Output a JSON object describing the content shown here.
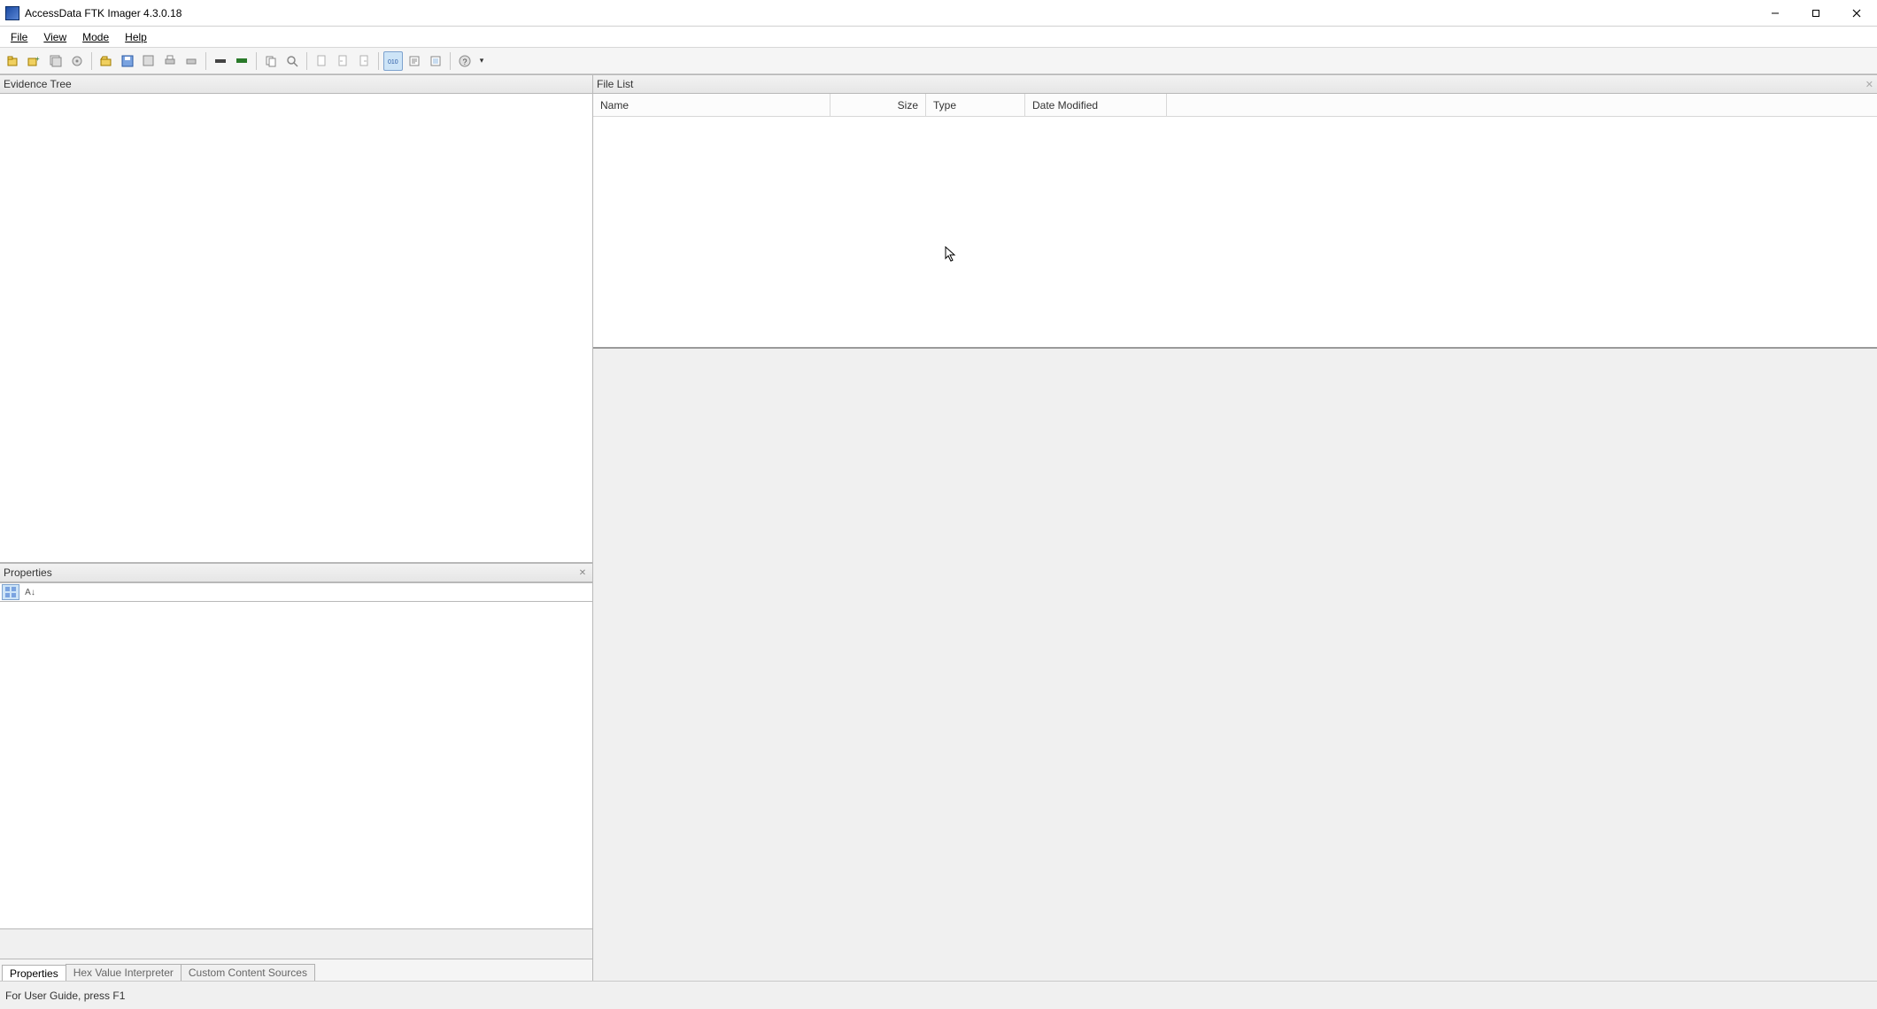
{
  "title": "AccessData FTK Imager 4.3.0.18",
  "menubar": {
    "file": "File",
    "view": "View",
    "mode": "Mode",
    "help": "Help"
  },
  "panels": {
    "evidence_tree": "Evidence Tree",
    "properties": "Properties",
    "file_list": "File List"
  },
  "file_list_columns": {
    "name": "Name",
    "size": "Size",
    "type": "Type",
    "date_modified": "Date Modified"
  },
  "bottom_tabs": {
    "properties": "Properties",
    "hex_interpreter": "Hex Value Interpreter",
    "custom_content": "Custom Content Sources"
  },
  "properties_sort": "A↓",
  "statusbar": "For User Guide, press F1",
  "toolbar_icons": [
    "add-evidence-icon",
    "add-evidence-plus-icon",
    "add-all-icon",
    "image-mount-icon",
    "open-folder-icon",
    "save-icon",
    "save-as-icon",
    "print-icon",
    "print-preview-icon",
    "usb-block-icon",
    "ram-icon",
    "copy-icon",
    "find-icon",
    "new-file-icon",
    "file-prev-icon",
    "file-next-icon",
    "hex-view-icon",
    "text-view-icon",
    "native-view-icon",
    "help-icon"
  ]
}
